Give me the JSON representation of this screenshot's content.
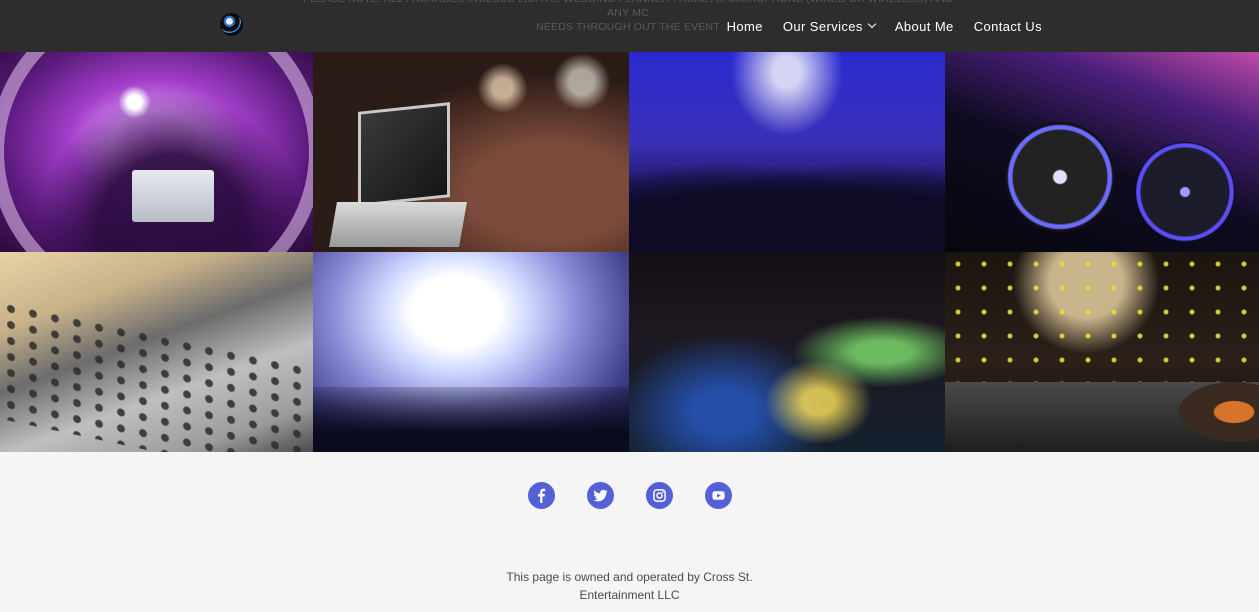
{
  "header": {
    "notice_line1": "PLEASE NOTE: ALL PACKAGES INCLUDE LIGHTS, WEDDING PLANNER PACKETS, MICROPHONE (WIRED OR WIRELESS) AND ANY MC",
    "notice_line2": "NEEDS THROUGH OUT THE EVENT",
    "nav": {
      "home": "Home",
      "services": "Our Services",
      "about": "About Me",
      "contact": "Contact Us"
    }
  },
  "gallery": {
    "images": [
      {
        "subject": "DJ with laptop under purple lights"
      },
      {
        "subject": "laptop and dancing crowd"
      },
      {
        "subject": "crowd under blue stage lights"
      },
      {
        "subject": "DJ turntables with neon lights"
      },
      {
        "subject": "audio mixing console"
      },
      {
        "subject": "concert crowd with confetti"
      },
      {
        "subject": "event hall with colored lights"
      },
      {
        "subject": "DJ hands on mixer and turntable"
      }
    ]
  },
  "footer": {
    "socials": [
      {
        "icon": "facebook-icon"
      },
      {
        "icon": "twitter-icon"
      },
      {
        "icon": "instagram-icon"
      },
      {
        "icon": "youtube-icon"
      }
    ],
    "owned_line1": "This page is owned and operated by Cross St.",
    "owned_line2": "Entertainment LLC"
  },
  "colors": {
    "header_bg": "#2d2d2d",
    "social_accent": "#5560d6",
    "footer_bg": "#f5f5f5"
  }
}
